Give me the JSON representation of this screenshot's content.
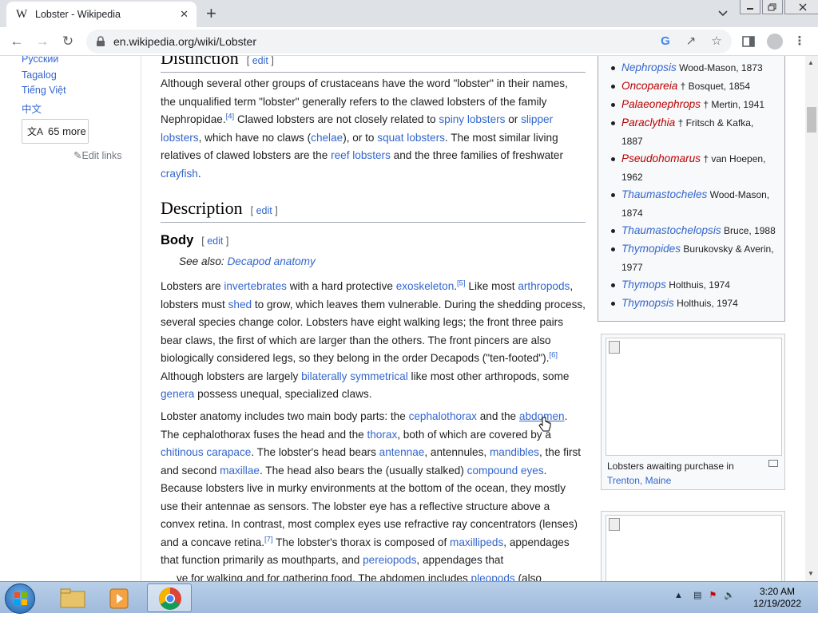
{
  "browser": {
    "tab_title": "Lobster - Wikipedia",
    "tab_favicon": "W",
    "url": "en.wikipedia.org/wiki/Lobster",
    "new_tab_label": "+",
    "close_tab_label": "✕"
  },
  "sidebar": {
    "languages": [
      "Русский",
      "Tagalog",
      "Tiếng Việt",
      "中文"
    ],
    "more_languages": "65 more",
    "edit_links": "Edit links"
  },
  "article": {
    "distinction_heading": "Distinction",
    "edit_label": "edit",
    "distinction_para": {
      "t1": "Although several other groups of crustaceans have the word \"lobster\" in their names, the unqualified term \"lobster\" generally refers to the clawed lobsters of the family Nephropidae.",
      "ref4": "[4]",
      "t2": " Clawed lobsters are not closely related to ",
      "l_spiny": "spiny lobsters",
      "t3": " or ",
      "l_slipper": "slipper lobsters",
      "t4": ", which have no claws (",
      "l_chelae": "chelae",
      "t5": "), or to ",
      "l_squat": "squat lobsters",
      "t6": ". The most similar living relatives of clawed lobsters are the ",
      "l_reef": "reef lobsters",
      "t7": " and the three families of freshwater ",
      "l_crayfish": "crayfish",
      "t8": "."
    },
    "description_heading": "Description",
    "body_heading": "Body",
    "see_also_label": "See also: ",
    "see_also_link": "Decapod anatomy",
    "body_para1": {
      "t1": "Lobsters are ",
      "l_invert": "invertebrates",
      "t2": " with a hard protective ",
      "l_exo": "exoskeleton",
      "t3": ".",
      "ref5": "[5]",
      "t4": " Like most ",
      "l_arthro": "arthropods",
      "t5": ", lobsters must ",
      "l_shed": "shed",
      "t6": " to grow, which leaves them vulnerable. During the shedding process, several species change color. Lobsters have eight walking legs; the front three pairs bear claws, the first of which are larger than the others. The front pincers are also biologically considered legs, so they belong in the order Decapods (\"ten-footed\").",
      "ref6": "[6]",
      "t7": " Although lobsters are largely ",
      "l_bilat": "bilaterally symmetrical",
      "t8": " like most other arthropods, some ",
      "l_genera": "genera",
      "t9": " possess unequal, specialized claws."
    },
    "body_para2": {
      "t1": "Lobster anatomy includes two main body parts: the ",
      "l_ceph": "cephalothorax",
      "t2": " and the ",
      "l_abd": "abdomen",
      "t3": ". The cephalothorax fuses the head and the ",
      "l_thorax": "thorax",
      "t4": ", both of which are covered by a ",
      "l_chit": "chitinous carapace",
      "t5": ". The lobster's head bears ",
      "l_ant": "antennae",
      "t6": ", antennules, ",
      "l_mand": "mandibles",
      "t7": ", the first and second ",
      "l_max": "maxillae",
      "t8": ". The head also bears the (usually stalked) ",
      "l_comp": "compound eyes",
      "t9": ". Because lobsters live in murky environments at the bottom of the ocean, they mostly use their antennae as sensors. The lobster eye has a reflective structure above a convex retina. In contrast, most complex eyes use refractive ray concentrators (lenses) and a concave retina.",
      "ref7": "[7]",
      "t10": " The lobster's thorax is composed of ",
      "l_maxil": "maxillipeds",
      "t11": ", appendages that function primarily as mouthparts, and ",
      "l_pere": "pereiopods",
      "t12": ", appendages that",
      "t13": "ve for walking and for gathering food. The abdomen includes ",
      "l_pleo": "pleopods",
      "t14": " (also"
    }
  },
  "genera": [
    {
      "name": "Nephropsis",
      "authority": "Wood-Mason, 1873",
      "red": false
    },
    {
      "name": "Oncopareia",
      "authority": "† Bosquet, 1854",
      "red": true
    },
    {
      "name": "Palaeonephrops",
      "authority": "† Mertin, 1941",
      "red": true
    },
    {
      "name": "Paraclythia",
      "authority": "† Fritsch & Kafka,",
      "authority2": "1887",
      "red": true
    },
    {
      "name": "Pseudohomarus",
      "authority": "† van Hoepen,",
      "authority2": "1962",
      "red": true
    },
    {
      "name": "Thaumastocheles",
      "authority": "Wood-Mason,",
      "authority2": "1874",
      "red": false
    },
    {
      "name": "Thaumastochelopsis",
      "authority": "Bruce, 1988",
      "red": false
    },
    {
      "name": "Thymopides",
      "authority": "Burukovsky & Averin,",
      "authority2": "1977",
      "red": false
    },
    {
      "name": "Thymops",
      "authority": "Holthuis, 1974",
      "red": false
    },
    {
      "name": "Thymopsis",
      "authority": "Holthuis, 1974",
      "red": false
    }
  ],
  "thumb1": {
    "caption": "Lobsters awaiting purchase in ",
    "caption_link": "Trenton, Maine"
  },
  "taskbar": {
    "time": "3:20 AM",
    "date": "12/19/2022"
  },
  "colors": {
    "link": "#3366cc",
    "redlink": "#ba0000",
    "accent_chrome": "#dee1e6"
  }
}
